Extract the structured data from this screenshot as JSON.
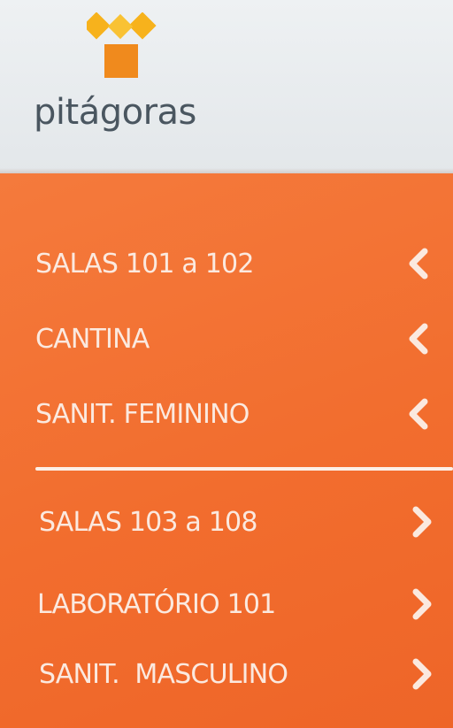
{
  "brand": {
    "name": "pitágoras",
    "logo_icon": "stacked-squares-logo-icon",
    "logo_color": "#f5a623",
    "text_color": "#4a5660"
  },
  "colors": {
    "panel": "#f26d2e",
    "text": "#fbe9df"
  },
  "group_left": {
    "arrow_icon": "chevron-left-icon",
    "items": [
      {
        "label": "SALAS 101 a 102"
      },
      {
        "label": "CANTINA"
      },
      {
        "label": "SANIT. FEMININO"
      }
    ]
  },
  "group_right": {
    "arrow_icon": "chevron-right-icon",
    "items": [
      {
        "label": "SALAS 103 a 108"
      },
      {
        "label": "LABORATÓRIO 101"
      },
      {
        "label": "SANIT.  MASCULINO"
      }
    ]
  }
}
